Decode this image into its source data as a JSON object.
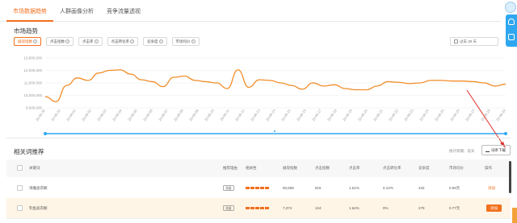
{
  "tabs": [
    {
      "label": "市场数据趋势",
      "active": true
    },
    {
      "label": "人群画像分析",
      "active": false
    },
    {
      "label": "竞争流量透视",
      "active": false
    }
  ],
  "trend": {
    "title": "市场趋势",
    "metrics": [
      {
        "label": "展现指数",
        "active": true
      },
      {
        "label": "点击指数",
        "active": false
      },
      {
        "label": "点击率",
        "active": false
      },
      {
        "label": "点击转化率",
        "active": false
      },
      {
        "label": "竞争度",
        "active": false
      },
      {
        "label": "市场均价",
        "active": false
      }
    ],
    "date_range": "过去 30 天"
  },
  "chart_data": {
    "type": "line",
    "y_ticks": [
      "13,000,000",
      "12,000,000",
      "11,000,000",
      "10,000,000",
      "9,000,000"
    ],
    "ylim": [
      9000000,
      13000000
    ],
    "x": [
      "20-05-30",
      "20-05-31",
      "20-06-01",
      "20-06-02",
      "20-06-03",
      "20-06-04",
      "20-06-05",
      "20-06-06",
      "20-06-07",
      "20-06-08",
      "20-06-09",
      "20-06-10",
      "20-06-11",
      "20-06-12",
      "20-06-13",
      "20-06-14",
      "20-06-15",
      "20-06-16",
      "20-06-17",
      "20-06-18",
      "20-06-19",
      "20-06-20",
      "20-06-21",
      "20-06-22",
      "20-06-23",
      "20-06-24",
      "20-06-25",
      "20-06-26",
      "20-06-27",
      "20-06-28",
      "20-06-29"
    ],
    "values": [
      9900000,
      9500000,
      10800000,
      11400000,
      11200000,
      11800000,
      12000000,
      12050000,
      11700000,
      11250000,
      11100000,
      10700000,
      11450000,
      11550000,
      11200000,
      11100000,
      11000000,
      10550000,
      12050000,
      10650000,
      11250000,
      11200000,
      11000000,
      10800000,
      10500000,
      11000000,
      10750000,
      10850000,
      10550000,
      10450000,
      10450000,
      10750000,
      11100000,
      11050000,
      10950000,
      11000000,
      11200000,
      11200000,
      11150000,
      11150000,
      11100000,
      11000000,
      10750000,
      10900000
    ],
    "line_color": "#f28c28"
  },
  "related": {
    "title": "相关词推荐",
    "stats_note": "统计周期：前天",
    "export_label": "词条下载",
    "columns": [
      "关键词",
      "推荐理由",
      "相关性",
      "展现指数",
      "点击指数",
      "点击率",
      "点击转化率",
      "竞争度",
      "市场均价",
      "操作"
    ],
    "rows": [
      {
        "keyword": "诗雅迪衣橱",
        "reason": "流量",
        "relevance": 5,
        "show": "50,669",
        "click": "815",
        "ctr": "1.61%",
        "cvr": "0.12%",
        "competition": "432",
        "price": "0.59元",
        "action": "添加",
        "highlight": false
      },
      {
        "keyword": "钓鱼迪衣橱",
        "reason": "流量",
        "relevance": 5,
        "show": "7,374",
        "click": "124",
        "ctr": "1.64%",
        "cvr": "0%",
        "competition": "279",
        "price": "0.77元",
        "action": "添加",
        "highlight": true
      }
    ]
  }
}
